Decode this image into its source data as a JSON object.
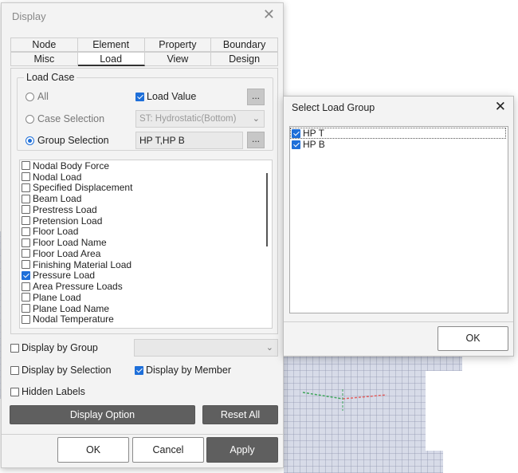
{
  "display_dialog": {
    "title": "Display",
    "tabs_row1": [
      "Node",
      "Element",
      "Property",
      "Boundary"
    ],
    "tabs_row2": [
      "Misc",
      "Load",
      "View",
      "Design"
    ],
    "active_tab": "Load",
    "load_case": {
      "legend": "Load Case",
      "all_label": "All",
      "load_value_label": "Load Value",
      "load_value_checked": true,
      "case_selection_label": "Case Selection",
      "case_selection_value": "ST: Hydrostatic(Bottom)",
      "group_selection_label": "Group Selection",
      "group_selection_value": "HP T,HP B",
      "selected_mode": "Group Selection",
      "browse_label": "..."
    },
    "load_items": [
      {
        "label": "Nodal Body Force",
        "checked": false
      },
      {
        "label": "Nodal Load",
        "checked": false
      },
      {
        "label": "Specified Displacement",
        "checked": false
      },
      {
        "label": "Beam Load",
        "checked": false
      },
      {
        "label": "Prestress Load",
        "checked": false
      },
      {
        "label": "Pretension Load",
        "checked": false
      },
      {
        "label": "Floor Load",
        "checked": false
      },
      {
        "label": "Floor Load Name",
        "checked": false
      },
      {
        "label": "Floor Load Area",
        "checked": false
      },
      {
        "label": "Finishing Material Load",
        "checked": false
      },
      {
        "label": "Pressure Load",
        "checked": true
      },
      {
        "label": "Area Pressure Loads",
        "checked": false
      },
      {
        "label": "Plane Load",
        "checked": false
      },
      {
        "label": "Plane Load Name",
        "checked": false
      },
      {
        "label": "Nodal Temperature",
        "checked": false
      }
    ],
    "display_by_group_label": "Display by Group",
    "display_by_group_checked": false,
    "display_by_group_value": "",
    "display_by_selection_label": "Display by Selection",
    "display_by_selection_checked": false,
    "display_by_member_label": "Display by Member",
    "display_by_member_checked": true,
    "hidden_labels_label": "Hidden Labels",
    "hidden_labels_checked": false,
    "display_option_label": "Display Option",
    "reset_all_label": "Reset All",
    "ok_label": "OK",
    "cancel_label": "Cancel",
    "apply_label": "Apply",
    "close_icon": "close-icon"
  },
  "select_load_group_dialog": {
    "title": "Select Load Group",
    "items": [
      {
        "label": "HP T",
        "checked": true
      },
      {
        "label": "HP B",
        "checked": true
      }
    ],
    "ok_label": "OK",
    "close_icon": "close-icon"
  },
  "colors": {
    "accent": "#1e6fd9",
    "dark_button": "#5f5f5f",
    "dialog_bg": "#f3f3f3",
    "mesh_fill": "#d4d8e6",
    "mesh_line": "#8c93ad"
  }
}
